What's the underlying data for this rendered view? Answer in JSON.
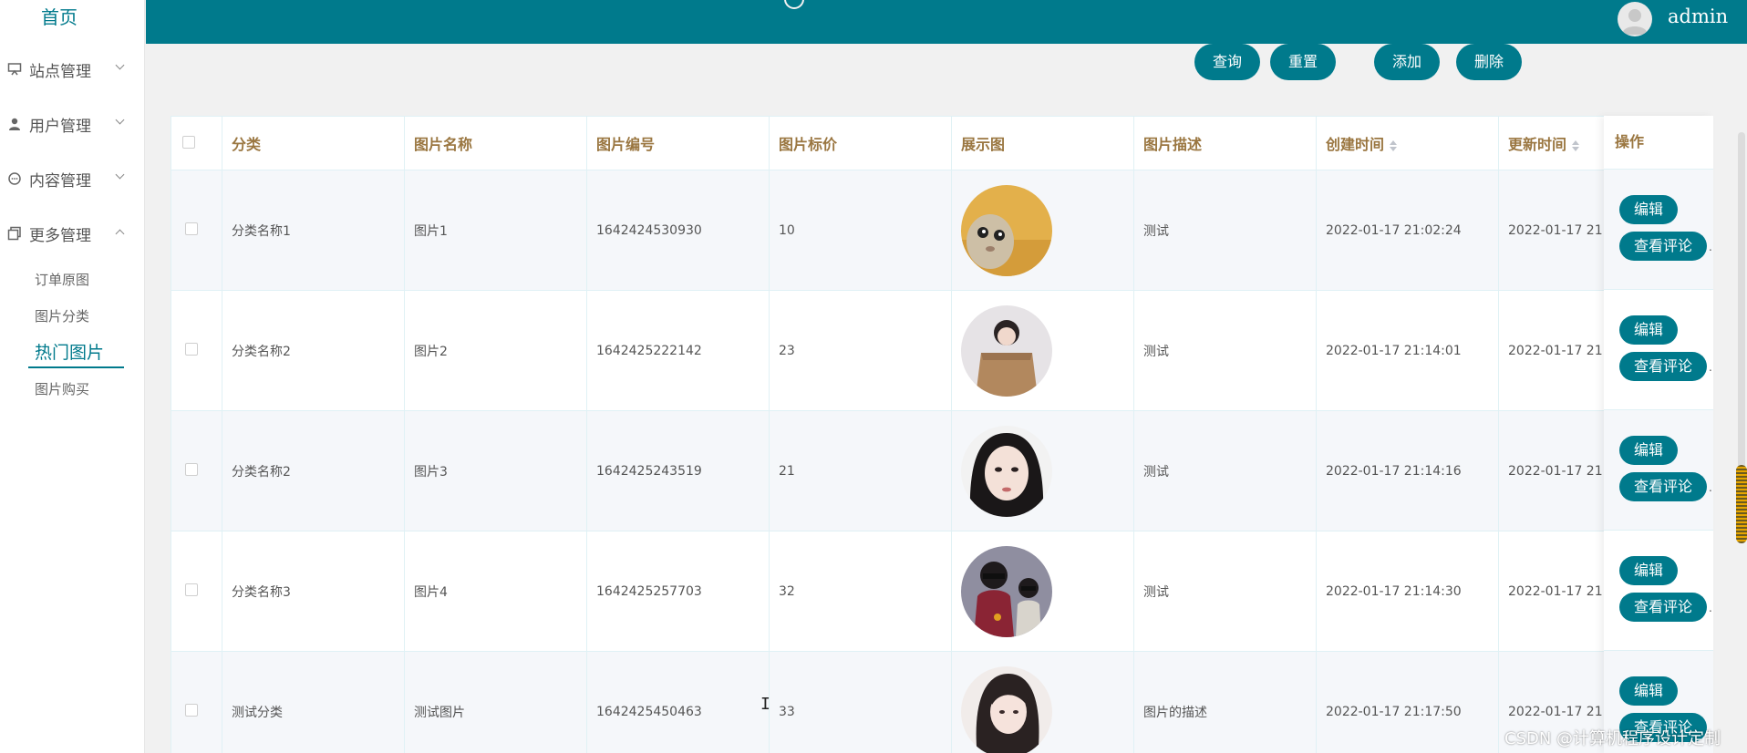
{
  "sidebar": {
    "home": "首页",
    "menu": [
      {
        "label": "站点管理",
        "icon": "monitor-icon"
      },
      {
        "label": "用户管理",
        "icon": "user-icon"
      },
      {
        "label": "内容管理",
        "icon": "chat-icon"
      },
      {
        "label": "更多管理",
        "icon": "copy-icon"
      }
    ],
    "submenu": [
      {
        "label": "订单原图"
      },
      {
        "label": "图片分类"
      },
      {
        "label": "热门图片",
        "active": true
      },
      {
        "label": "图片购买"
      }
    ]
  },
  "header": {
    "username": "admin"
  },
  "actions": {
    "query": "查询",
    "reset": "重置",
    "add": "添加",
    "delete": "删除"
  },
  "table": {
    "columns": [
      "分类",
      "图片名称",
      "图片编号",
      "图片标价",
      "展示图",
      "图片描述",
      "创建时间",
      "更新时间",
      "操作"
    ],
    "rows": [
      {
        "category": "分类名称1",
        "name": "图片1",
        "code": "1642424530930",
        "price": "10",
        "desc": "测试",
        "created": "2022-01-17 21:02:24",
        "updated": "2022-01-17 21"
      },
      {
        "category": "分类名称2",
        "name": "图片2",
        "code": "1642425222142",
        "price": "23",
        "desc": "测试",
        "created": "2022-01-17 21:14:01",
        "updated": "2022-01-17 21"
      },
      {
        "category": "分类名称2",
        "name": "图片3",
        "code": "1642425243519",
        "price": "21",
        "desc": "测试",
        "created": "2022-01-17 21:14:16",
        "updated": "2022-01-17 21"
      },
      {
        "category": "分类名称3",
        "name": "图片4",
        "code": "1642425257703",
        "price": "32",
        "desc": "测试",
        "created": "2022-01-17 21:14:30",
        "updated": "2022-01-17 21"
      },
      {
        "category": "测试分类",
        "name": "测试图片",
        "code": "1642425450463",
        "price": "33",
        "desc": "图片的描述",
        "created": "2022-01-17 21:17:50",
        "updated": "2022-01-17 21"
      }
    ],
    "row_actions": {
      "edit": "编辑",
      "view_comments": "查看评论"
    }
  },
  "watermark": "CSDN @计算机程序设计定制",
  "colors": {
    "brand": "#007a8c",
    "header_text": "#9a7640",
    "stripe": "#f5f7fa"
  }
}
